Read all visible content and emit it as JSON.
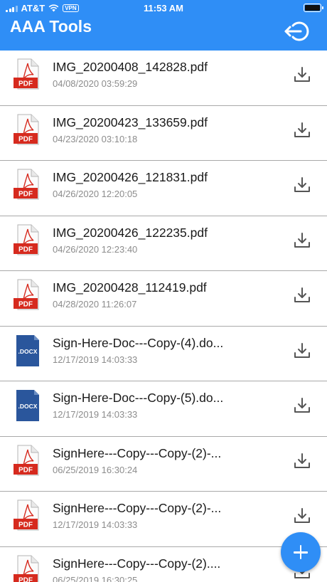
{
  "status_bar": {
    "carrier": "AT&T",
    "vpn": "VPN",
    "time": "11:53 AM"
  },
  "header": {
    "title": "AAA Tools",
    "logout_icon": "logout-icon"
  },
  "files": [
    {
      "name": "IMG_20200408_142828.pdf",
      "date": "04/08/2020 03:59:29",
      "type": "pdf",
      "badge": "PDF"
    },
    {
      "name": "IMG_20200423_133659.pdf",
      "date": "04/23/2020 03:10:18",
      "type": "pdf",
      "badge": "PDF"
    },
    {
      "name": "IMG_20200426_121831.pdf",
      "date": "04/26/2020 12:20:05",
      "type": "pdf",
      "badge": "PDF"
    },
    {
      "name": "IMG_20200426_122235.pdf",
      "date": "04/26/2020 12:23:40",
      "type": "pdf",
      "badge": "PDF"
    },
    {
      "name": "IMG_20200428_112419.pdf",
      "date": "04/28/2020 11:26:07",
      "type": "pdf",
      "badge": "PDF"
    },
    {
      "name": "Sign-Here-Doc---Copy-(4).do...",
      "date": "12/17/2019 14:03:33",
      "type": "docx",
      "badge": ".DOCX"
    },
    {
      "name": "Sign-Here-Doc---Copy-(5).do...",
      "date": "12/17/2019 14:03:33",
      "type": "docx",
      "badge": ".DOCX"
    },
    {
      "name": "SignHere---Copy---Copy-(2)-...",
      "date": "06/25/2019 16:30:24",
      "type": "pdf",
      "badge": "PDF"
    },
    {
      "name": "SignHere---Copy---Copy-(2)-...",
      "date": "12/17/2019 14:03:33",
      "type": "pdf",
      "badge": "PDF"
    },
    {
      "name": "SignHere---Copy---Copy-(2)....",
      "date": "06/25/2019 16:30:25",
      "type": "pdf",
      "badge": "PDF"
    }
  ],
  "fab": {
    "icon": "plus-icon"
  },
  "colors": {
    "header": "#2f8ef6",
    "pdf_badge": "#d62a1e",
    "docx": "#2a569c",
    "divider": "#a9a9a9",
    "date_text": "#8c8c8c"
  }
}
